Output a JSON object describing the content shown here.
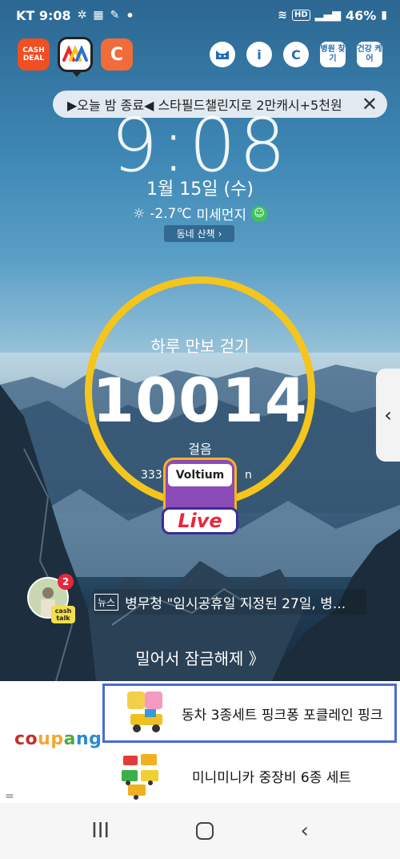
{
  "status_bar": {
    "carrier_time": "KT 9:08",
    "dot": "•",
    "hd": "HD",
    "battery": "46%"
  },
  "apps": {
    "cashdeal_label": "CASH DEAL",
    "cashcat_glyph": "C"
  },
  "right_icons": {
    "hospital_label": "병원 찾기",
    "health_label": "건강 케어",
    "info_glyph": "i",
    "coin_glyph": "C"
  },
  "banner": {
    "text": "▶오늘 밤 종료◀ 스타필드챌린지로 2만캐시+5천원",
    "close": "✕"
  },
  "lock": {
    "time": "9:08",
    "date": "1월 15일 (수)",
    "temperature": "-2.7℃",
    "dust_label": "미세먼지",
    "walk_button": "동네 산책",
    "walk_arrow": "›"
  },
  "steps": {
    "title": "하루 만보 걷기",
    "count": "10014",
    "unit": "걸음",
    "sub_prefix": "333",
    "sub_suffix": "n"
  },
  "voltium": {
    "label": "Voltium",
    "live": "Live"
  },
  "side_handle_arrow": "‹",
  "news": {
    "badge_count": "2",
    "cashtalk_label": "cash talk",
    "tag": "뉴스",
    "headline": "병무청 \"임시공휴일 지정된 27일, 병..."
  },
  "unlock_text": "밀어서 잠금해제 》",
  "ad": {
    "brand": "coupang",
    "brand_colors": [
      "#c4302b",
      "#f2a735",
      "#53a846",
      "#2c8ad6"
    ],
    "item1": "동차 3종세트 핑크퐁 포클레인 핑크",
    "item2": "미니미니카 중장비 6종 세트",
    "menu": "="
  },
  "navbar": {
    "recent": "III",
    "back": "‹"
  },
  "colors": {
    "ring": "#f4c51c",
    "ad_border": "#4a6cd1",
    "live_red": "#e8273b"
  }
}
